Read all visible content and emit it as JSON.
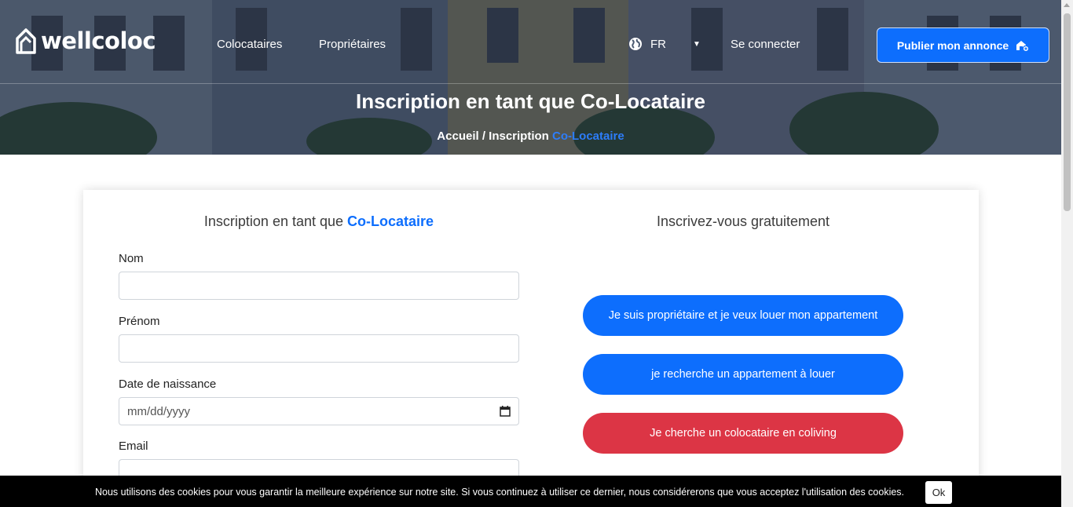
{
  "header": {
    "logo_text": "wellcoloc",
    "nav": [
      "Colocataires",
      "Propriétaires"
    ],
    "language": "FR",
    "login": "Se connecter",
    "publish_button": "Publier mon annonce"
  },
  "hero": {
    "title": "Inscription en tant que Co-Locataire",
    "breadcrumb_prefix": "Accueil / Inscription",
    "breadcrumb_highlight": "Co-Locataire"
  },
  "form": {
    "title_prefix": "Inscription en tant que",
    "title_highlight": "Co-Locataire",
    "fields": {
      "nom": {
        "label": "Nom",
        "value": ""
      },
      "prenom": {
        "label": "Prénom",
        "value": ""
      },
      "birthdate": {
        "label": "Date de naissance",
        "placeholder": "mm/dd/yyyy"
      },
      "email": {
        "label": "Email",
        "value": ""
      }
    }
  },
  "signup": {
    "title": "Inscrivez-vous gratuitement",
    "buttons": [
      {
        "label": "Je suis propriétaire et je veux louer mon appartement",
        "color": "#0d6efd"
      },
      {
        "label": "je recherche un appartement à louer",
        "color": "#0d6efd"
      },
      {
        "label": "Je cherche un colocataire en coliving",
        "color": "#dc3545"
      }
    ]
  },
  "cookie": {
    "message": "Nous utilisons des cookies pour vous garantir la meilleure expérience sur notre site.   Si vous continuez à utiliser ce dernier, nous considérerons que vous acceptez l'utilisation des cookies.",
    "ok": "Ok"
  },
  "colors": {
    "primary": "#0d6efd",
    "danger": "#dc3545",
    "cookie_bg": "#000000"
  }
}
